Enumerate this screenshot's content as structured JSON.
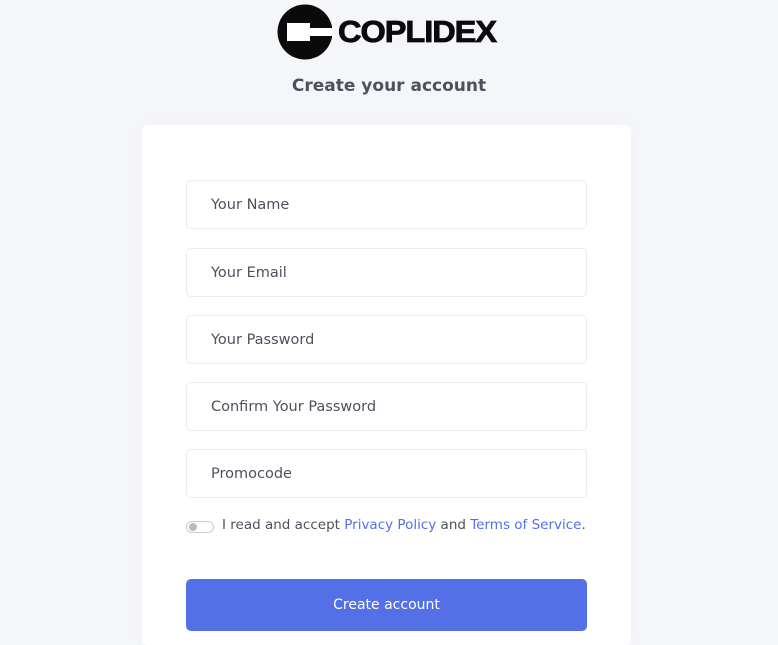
{
  "brand": {
    "name": "COPLIDEX",
    "logo_icon": "coplidex-logo-mark"
  },
  "page": {
    "subtitle": "Create your account"
  },
  "form": {
    "fields": [
      {
        "name": "name",
        "type": "text",
        "placeholder": "Your Name",
        "value": ""
      },
      {
        "name": "email",
        "type": "email",
        "placeholder": "Your Email",
        "value": ""
      },
      {
        "name": "password",
        "type": "password",
        "placeholder": "Your Password",
        "value": ""
      },
      {
        "name": "confirm_password",
        "type": "password",
        "placeholder": "Confirm Your Password",
        "value": ""
      },
      {
        "name": "promocode",
        "type": "text",
        "placeholder": "Promocode",
        "value": ""
      }
    ],
    "terms": {
      "toggle_on": false,
      "text_before": "I read and accept ",
      "privacy_link": "Privacy Policy",
      "text_middle": " and ",
      "terms_link": "Terms of Service",
      "text_after": "."
    },
    "submit_label": "Create account"
  },
  "colors": {
    "accent": "#5470e6",
    "background": "#f5f6f9",
    "text": "#4b525c"
  }
}
